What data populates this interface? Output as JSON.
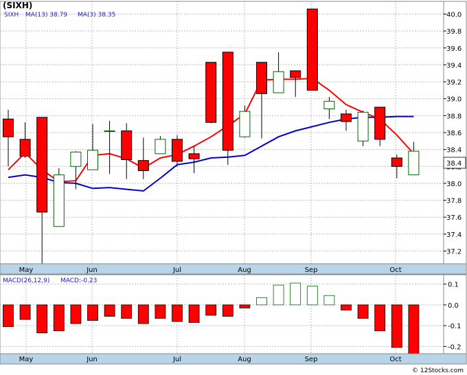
{
  "title": "(SIXH)",
  "legend": {
    "symbol": "SIXH",
    "ma13": "MA(13)  38.79",
    "ma3": "MA(3)  38.35"
  },
  "last_price": "38.4",
  "macd_legend": {
    "name": "MACD(26,12,9)",
    "value": "MACD:-0.23"
  },
  "watermark": "© 12Stocks.com",
  "colors": {
    "up": "#ffffff",
    "up_border": "#006600",
    "down": "#ff0000",
    "ma13": "#0000cc",
    "ma3": "#ff0000",
    "grid": "#bbbbbb",
    "axis_band": "#b8d4e8"
  },
  "chart_data": [
    {
      "type": "candlestick",
      "title": "(SIXH)",
      "x_tick_labels": [
        "May",
        "Jun",
        "Jul",
        "Aug",
        "Sep",
        "Oct"
      ],
      "ylim": [
        37.05,
        40.15
      ],
      "y_ticks": [
        37.2,
        37.4,
        37.6,
        37.8,
        38.0,
        38.2,
        38.4,
        38.6,
        38.8,
        39.0,
        39.2,
        39.4,
        39.6,
        39.8,
        40.0
      ],
      "grid": true,
      "candles": [
        {
          "open": 38.76,
          "high": 38.87,
          "low": 38.2,
          "close": 38.55
        },
        {
          "open": 38.52,
          "high": 38.72,
          "low": 38.3,
          "close": 38.32
        },
        {
          "open": 38.78,
          "high": 38.78,
          "low": 37.05,
          "close": 37.66
        },
        {
          "open": 37.49,
          "high": 38.18,
          "low": 37.49,
          "close": 38.1
        },
        {
          "open": 38.2,
          "high": 38.38,
          "low": 37.93,
          "close": 38.37
        },
        {
          "open": 38.16,
          "high": 38.7,
          "low": 38.16,
          "close": 38.39
        },
        {
          "open": 38.62,
          "high": 38.74,
          "low": 38.11,
          "close": 38.62
        },
        {
          "open": 38.62,
          "high": 38.71,
          "low": 38.05,
          "close": 38.28
        },
        {
          "open": 38.27,
          "high": 38.54,
          "low": 38.05,
          "close": 38.15
        },
        {
          "open": 38.35,
          "high": 38.56,
          "low": 38.35,
          "close": 38.52
        },
        {
          "open": 38.52,
          "high": 38.57,
          "low": 38.2,
          "close": 38.26
        },
        {
          "open": 38.35,
          "high": 38.44,
          "low": 38.12,
          "close": 38.29
        },
        {
          "open": 39.43,
          "high": 39.43,
          "low": 38.71,
          "close": 38.72
        },
        {
          "open": 39.55,
          "high": 39.55,
          "low": 38.22,
          "close": 38.39
        },
        {
          "open": 38.55,
          "high": 38.92,
          "low": 38.54,
          "close": 38.85
        },
        {
          "open": 39.43,
          "high": 39.43,
          "low": 38.53,
          "close": 39.06
        },
        {
          "open": 39.07,
          "high": 39.55,
          "low": 39.07,
          "close": 39.32
        },
        {
          "open": 39.33,
          "high": 39.33,
          "low": 39.02,
          "close": 39.25
        },
        {
          "open": 40.06,
          "high": 40.06,
          "low": 39.1,
          "close": 39.1
        },
        {
          "open": 38.88,
          "high": 39.02,
          "low": 38.76,
          "close": 38.97
        },
        {
          "open": 38.82,
          "high": 38.87,
          "low": 38.62,
          "close": 38.73
        },
        {
          "open": 38.5,
          "high": 38.86,
          "low": 38.44,
          "close": 38.84
        },
        {
          "open": 38.9,
          "high": 38.9,
          "low": 38.44,
          "close": 38.52
        },
        {
          "open": 38.3,
          "high": 38.34,
          "low": 38.06,
          "close": 38.2
        },
        {
          "open": 38.1,
          "high": 38.49,
          "low": 38.1,
          "close": 38.38
        }
      ],
      "series": [
        {
          "name": "MA(13)",
          "start_index": 0,
          "values": [
            38.07,
            38.1,
            38.07,
            38.01,
            38.0,
            37.94,
            37.95,
            37.93,
            37.91,
            38.06,
            38.22,
            38.25,
            38.3,
            38.31,
            38.33,
            38.44,
            38.55,
            38.62,
            38.67,
            38.72,
            38.76,
            38.78,
            38.78,
            38.79,
            38.79
          ]
        },
        {
          "name": "MA(3)",
          "start_index": 0,
          "values": [
            38.16,
            38.36,
            38.16,
            38.02,
            38.03,
            38.33,
            38.35,
            38.29,
            38.18,
            38.3,
            38.34,
            38.44,
            38.55,
            38.68,
            38.82,
            39.22,
            39.23,
            39.23,
            39.24,
            39.1,
            38.93,
            38.84,
            38.76,
            38.57,
            38.35
          ]
        }
      ]
    },
    {
      "type": "bar",
      "title": "MACD(26,12,9)",
      "ylim": [
        -0.235,
        0.145
      ],
      "y_ticks": [
        0.1,
        0.0,
        -0.1,
        -0.2
      ],
      "y_tick_labels": [
        "0.1",
        "0.0",
        "-0.1",
        "-0.2"
      ],
      "x_tick_labels": [
        "May",
        "Jun",
        "Jul",
        "Aug",
        "Sep",
        "Oct"
      ],
      "values": [
        -0.105,
        -0.07,
        -0.135,
        -0.125,
        -0.09,
        -0.075,
        -0.055,
        -0.065,
        -0.09,
        -0.065,
        -0.08,
        -0.085,
        -0.05,
        -0.055,
        -0.015,
        0.035,
        0.095,
        0.105,
        0.09,
        0.045,
        -0.025,
        -0.065,
        -0.125,
        -0.205,
        -0.235
      ]
    }
  ]
}
